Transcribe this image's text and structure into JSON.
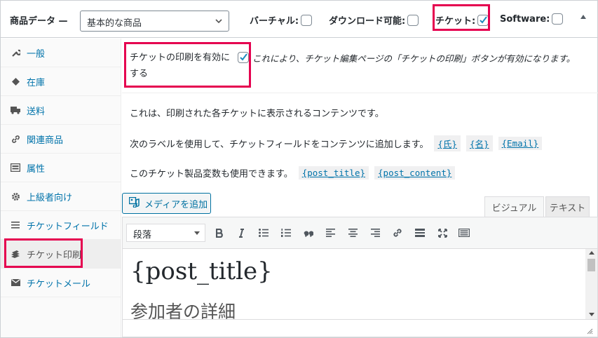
{
  "header": {
    "title": "商品データ —",
    "product_type": "基本的な商品",
    "options": [
      {
        "label": "バーチャル:",
        "checked": false
      },
      {
        "label": "ダウンロード可能:",
        "checked": false
      },
      {
        "label": "チケット:",
        "checked": true
      },
      {
        "label": "Software:",
        "checked": false
      }
    ],
    "collapse_icon": "triangle-up-icon"
  },
  "sidebar": {
    "items": [
      {
        "label": "一般",
        "icon": "wrench-icon"
      },
      {
        "label": "在庫",
        "icon": "tag-icon"
      },
      {
        "label": "送料",
        "icon": "truck-icon"
      },
      {
        "label": "関連商品",
        "icon": "link-icon"
      },
      {
        "label": "属性",
        "icon": "list-box-icon"
      },
      {
        "label": "上級者向け",
        "icon": "gear-icon"
      },
      {
        "label": "チケットフィールド",
        "icon": "lines-icon"
      },
      {
        "label": "チケット印刷",
        "icon": "printer-icon"
      },
      {
        "label": "チケットメール",
        "icon": "envelope-icon"
      }
    ],
    "active_index": 7
  },
  "main": {
    "enable_label": "チケットの印刷を有効にする",
    "enable_checked": true,
    "enable_desc": "これにより、チケット編集ページの「チケットの印刷」ボタンが有効になります。",
    "para1": "これは、印刷された各チケットに表示されるコンテンツです。",
    "para2": "次のラベルを使用して、チケットフィールドをコンテンツに追加します。",
    "para2_codes": [
      "{氏}",
      "{名}",
      "{Email}"
    ],
    "para3": "このチケット製品変数も使用できます。",
    "para3_codes": [
      "{post_title}",
      "{post_content}"
    ],
    "media_button": "メディアを追加",
    "tab_visual": "ビジュアル",
    "tab_text": "テキスト",
    "format_select": "段落",
    "editor_heading": "{post_title}",
    "editor_subheading": "参加者の詳細"
  },
  "colors": {
    "highlight": "#e5004f",
    "link": "#0073aa",
    "checkbox_check": "#1e8cbe"
  }
}
